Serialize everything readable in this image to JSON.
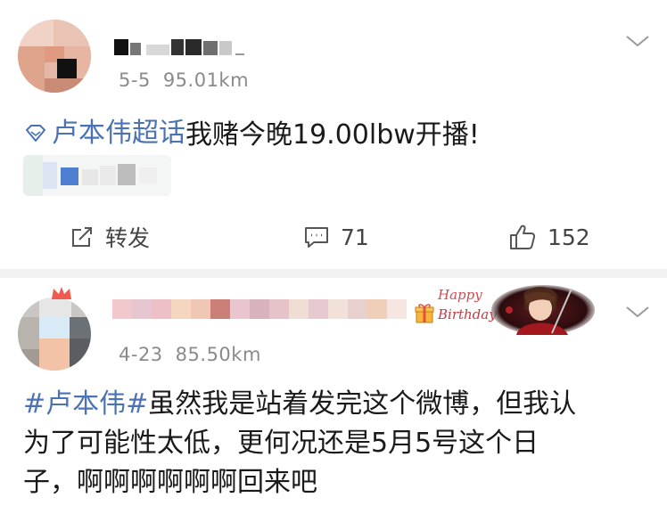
{
  "posts": [
    {
      "date": "5-5",
      "distance": "95.01km",
      "topic": "卢本伟超话",
      "text": "我赌今晚19.00lbw开播!",
      "actions": {
        "repost_label": "转发",
        "comment_count": "71",
        "like_count": "152"
      }
    },
    {
      "date": "4-23",
      "distance": "85.50km",
      "topic": "#卢本伟#",
      "lines": [
        "虽然我是站着发完这个微博，但我认",
        "为了可能性太低，更何况还是5月5号这个日",
        "子，啊啊啊啊啊啊回来吧"
      ],
      "badge": {
        "line1": "Happy",
        "line2": "Birthday"
      }
    }
  ],
  "colors": {
    "topic_link": "#4b72b5",
    "meta_gray": "#8a8a8a",
    "separator": "#f2f2f2"
  }
}
